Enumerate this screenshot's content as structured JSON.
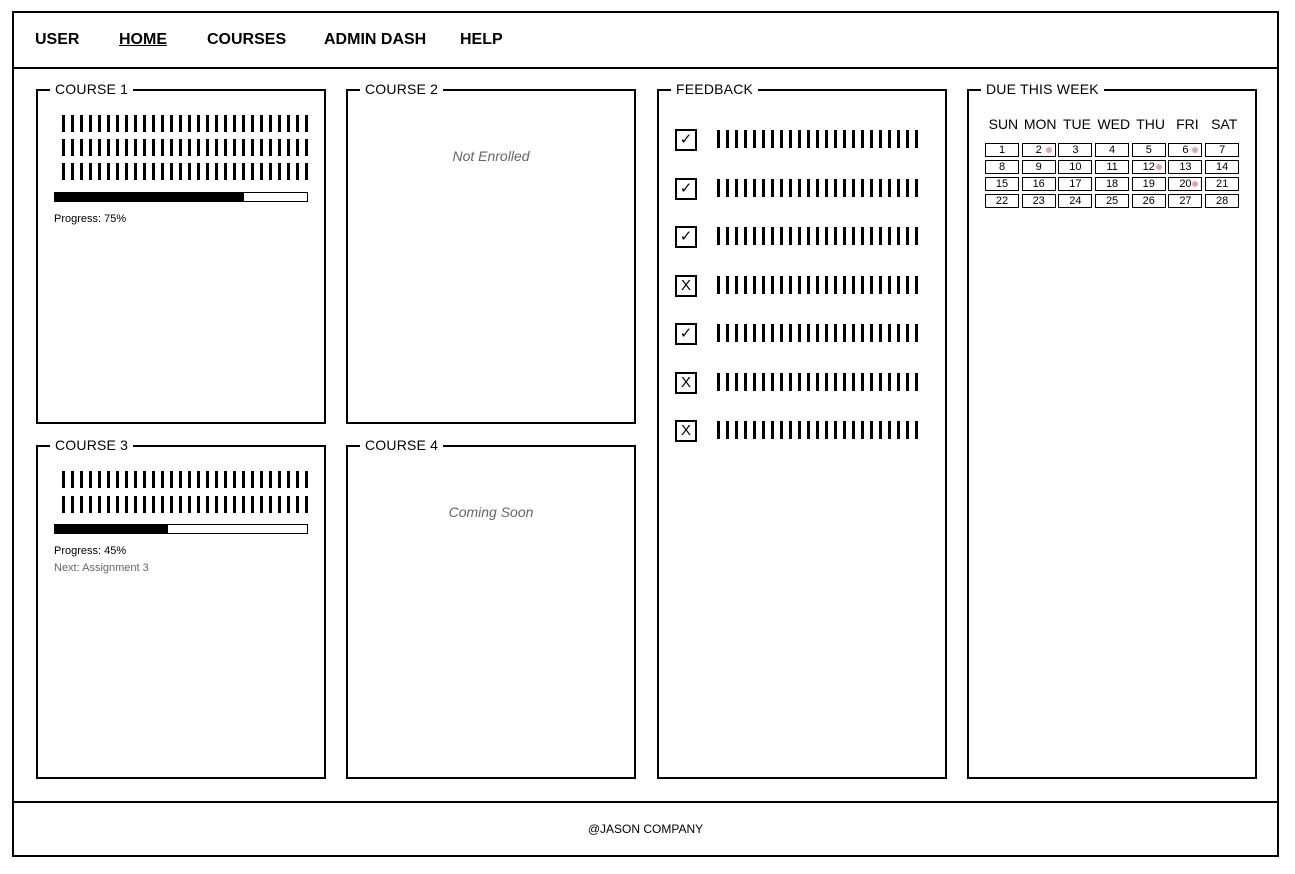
{
  "nav": {
    "items": [
      {
        "label": "USER"
      },
      {
        "label": "HOME",
        "active": true
      },
      {
        "label": "COURSES"
      },
      {
        "label": "ADMIN DASH"
      },
      {
        "label": "HELP"
      }
    ]
  },
  "courses": {
    "c1": {
      "title": "COURSE 1",
      "progress_pct": 75,
      "progress_text": "Progress: 75%"
    },
    "c2": {
      "title": "COURSE 2",
      "status": "Not Enrolled"
    },
    "c3": {
      "title": "COURSE 3",
      "progress_pct": 45,
      "progress_text": "Progress: 45%",
      "next": "Next: Assignment 3"
    },
    "c4": {
      "title": "COURSE 4",
      "status": "Coming Soon"
    }
  },
  "feedback": {
    "title": "FEEDBACK",
    "items": [
      {
        "icon": "check-icon",
        "glyph": "✓"
      },
      {
        "icon": "check-icon",
        "glyph": "✓"
      },
      {
        "icon": "check-icon",
        "glyph": "✓"
      },
      {
        "icon": "x-icon",
        "glyph": "X"
      },
      {
        "icon": "check-icon",
        "glyph": "✓"
      },
      {
        "icon": "x-icon",
        "glyph": "X"
      },
      {
        "icon": "x-icon",
        "glyph": "X"
      }
    ]
  },
  "calendar": {
    "title": "DUE THIS WEEK",
    "weekdays": [
      "SUN",
      "MON",
      "TUE",
      "WED",
      "THU",
      "FRI",
      "SAT"
    ],
    "days": [
      "1",
      "2",
      "3",
      "4",
      "5",
      "6",
      "7",
      "8",
      "9",
      "10",
      "11",
      "12",
      "13",
      "14",
      "15",
      "16",
      "17",
      "18",
      "19",
      "20",
      "21",
      "22",
      "23",
      "24",
      "25",
      "26",
      "27",
      "28"
    ],
    "marked": [
      "2",
      "6",
      "12",
      "20"
    ],
    "marker_color": "#e6a5ad"
  },
  "footer": {
    "text": "@JASON COMPANY"
  }
}
